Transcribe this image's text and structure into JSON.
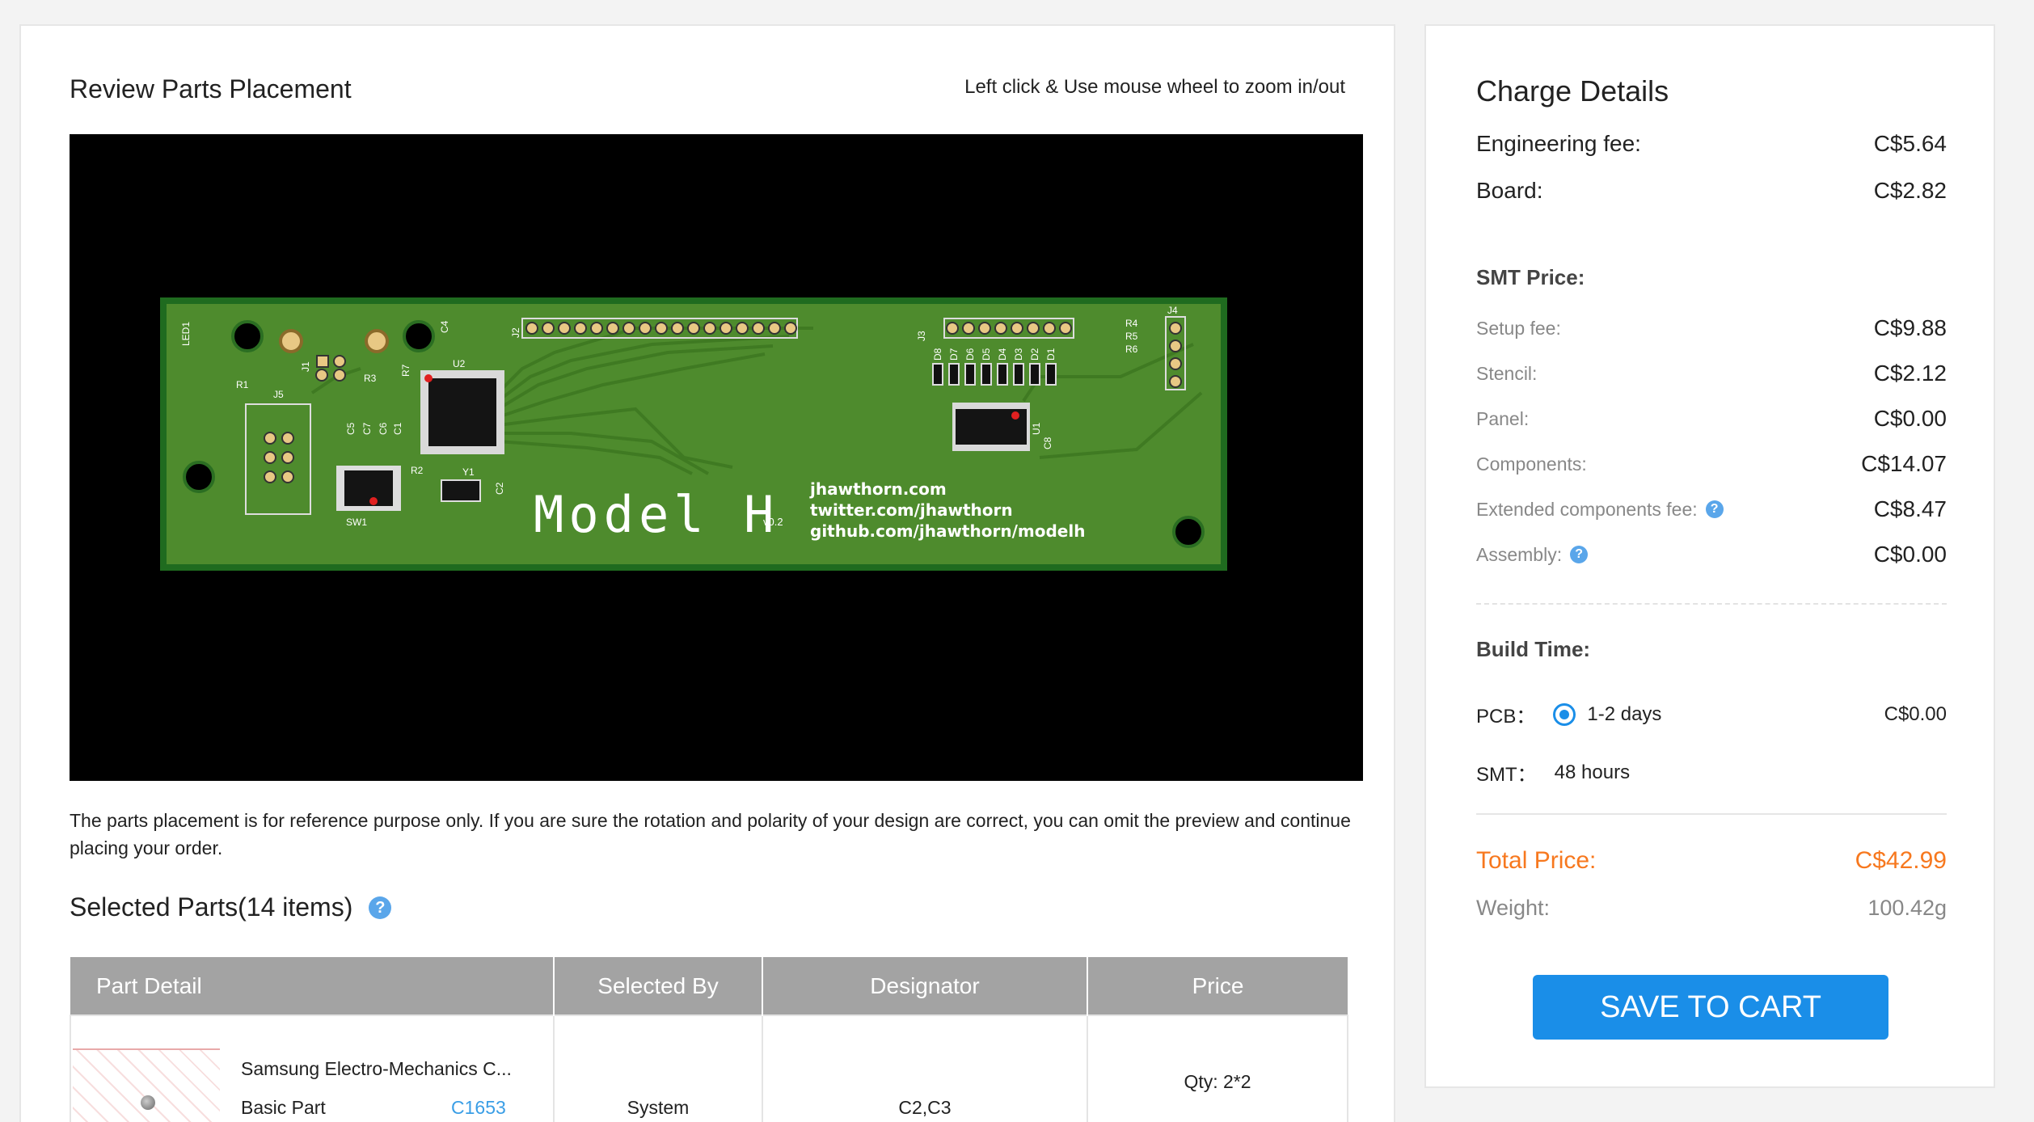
{
  "placement": {
    "title": "Review Parts Placement",
    "hint": "Left click & Use mouse wheel to zoom in/out",
    "note": "The parts placement is for reference purpose only. If you are sure the rotation and polarity of your design are correct, you can omit the preview and continue placing your order.",
    "pcb": {
      "model": "Model H",
      "version": "v0.2",
      "url_1": "jhawthorn.com",
      "url_2": "twitter.com/jhawthorn",
      "url_3": "github.com/jhawthorn/modelh",
      "labels": {
        "led1": "LED1",
        "r1": "R1",
        "j5": "J5",
        "j1": "J1",
        "r3": "R3",
        "r7": "R7",
        "c4": "C4",
        "u2": "U2",
        "j2": "J2",
        "j3": "J3",
        "j4": "J4",
        "r4": "R4",
        "r5": "R5",
        "r6": "R6",
        "sw1": "SW1",
        "r2": "R2",
        "y1": "Y1",
        "c2": "C2",
        "u1": "U1",
        "c8": "C8",
        "c5": "C5",
        "c7": "C7",
        "c6": "C6",
        "c1": "C1",
        "d8": "D8",
        "d7": "D7",
        "d6": "D6",
        "d5": "D5",
        "d4": "D4",
        "d3": "D3",
        "d2": "D2",
        "d1": "D1"
      }
    }
  },
  "selected_parts": {
    "title": "Selected Parts(14 items)",
    "columns": [
      "Part Detail",
      "Selected By",
      "Designator",
      "Price"
    ],
    "rows": [
      {
        "name": "Samsung Electro-Mechanics C...",
        "type": "Basic Part",
        "code": "C1653",
        "selected_by": "System",
        "designator": "C2,C3",
        "qty": "Qty: 2*2"
      }
    ]
  },
  "charge": {
    "title": "Charge Details",
    "engineering_fee_label": "Engineering fee:",
    "engineering_fee": "C$5.64",
    "board_label": "Board:",
    "board": "C$2.82",
    "smt_title": "SMT Price:",
    "setup_label": "Setup fee:",
    "setup": "C$9.88",
    "stencil_label": "Stencil:",
    "stencil": "C$2.12",
    "panel_label": "Panel:",
    "panel": "C$0.00",
    "components_label": "Components:",
    "components": "C$14.07",
    "extended_label": "Extended components fee:",
    "extended": "C$8.47",
    "assembly_label": "Assembly:",
    "assembly": "C$0.00",
    "build_title": "Build Time:",
    "pcb_label": "PCB：",
    "pcb_option": "1-2 days",
    "pcb_price": "C$0.00",
    "smt_label": "SMT：",
    "smt_time": "48 hours",
    "total_label": "Total Price:",
    "total": "C$42.99",
    "weight_label": "Weight:",
    "weight": "100.42g",
    "save_label": "SAVE TO CART"
  },
  "colors": {
    "accent": "#1a8ee8",
    "total": "#f7781e",
    "pcb_green": "#4d8a2c",
    "link": "#3a9ee6"
  }
}
